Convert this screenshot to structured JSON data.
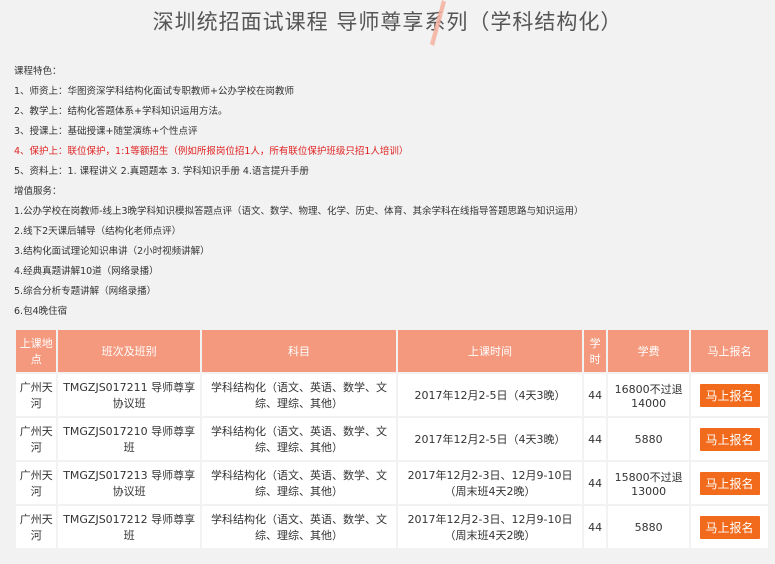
{
  "page": {
    "title": "深圳统招面试课程 导师尊享系列（学科结构化）"
  },
  "intro": {
    "heading": "课程特色：",
    "features": [
      {
        "text": "1、师资上：华图资深学科结构化面试专职教师+公办学校在岗教师",
        "red": false
      },
      {
        "text": "2、教学上：结构化答题体系+学科知识运用方法。",
        "red": false
      },
      {
        "text": "3、授课上：基础授课+随堂演练+个性点评",
        "red": false
      },
      {
        "text": "4、保护上：联位保护，1:1等额招生（例如所报岗位招1人，所有联位保护班级只招1人培训）",
        "red": true
      },
      {
        "text": "5、资料上：1. 课程讲义 2.真题题本 3. 学科知识手册 4.语言提升手册",
        "red": false
      }
    ],
    "service_heading": "增值服务：",
    "services": [
      "1.公办学校在岗教师-线上3晚学科知识模拟答题点评（语文、数学、物理、化学、历史、体育、其余学科在线指导答题思路与知识运用）",
      "2.线下2天课后辅导（结构化老师点评）",
      "3.结构化面试理论知识串讲（2小时视频讲解）",
      "4.经典真题讲解10道（网络录播）",
      "5.综合分析专题讲解（网络录播）",
      "6.包4晚住宿"
    ]
  },
  "table": {
    "headers": [
      "上课地点",
      "班次及班别",
      "科目",
      "上课时间",
      "学时",
      "学费",
      "马上报名"
    ],
    "rows": [
      {
        "location": "广州天河",
        "class": "TMGZJS017211 导师尊享协议班",
        "subject": "学科结构化（语文、英语、数学、文综、理综、其他）",
        "time": "2017年12月2-5日（4天3晚）",
        "hours": "44",
        "fee": "16800不过退14000",
        "action": "马上报名"
      },
      {
        "location": "广州天河",
        "class": "TMGZJS017210 导师尊享班",
        "subject": "学科结构化（语文、英语、数学、文综、理综、其他）",
        "time": "2017年12月2-5日（4天3晚）",
        "hours": "44",
        "fee": "5880",
        "action": "马上报名"
      },
      {
        "location": "广州天河",
        "class": "TMGZJS017213 导师尊享协议班",
        "subject": "学科结构化（语文、英语、数学、文综、理综、其他）",
        "time": "2017年12月2-3日、12月9-10日（周末班4天2晚）",
        "hours": "44",
        "fee": "15800不过退13000",
        "action": "马上报名"
      },
      {
        "location": "广州天河",
        "class": "TMGZJS017212 导师尊享班",
        "subject": "学科结构化（语文、英语、数学、文综、理综、其他）",
        "time": "2017年12月2-3日、12月9-10日（周末班4天2晚）",
        "hours": "44",
        "fee": "5880",
        "action": "马上报名"
      }
    ]
  },
  "colors": {
    "header_bg": "#f4997d",
    "button_bg": "#f26a1b",
    "highlight": "#e02020"
  }
}
